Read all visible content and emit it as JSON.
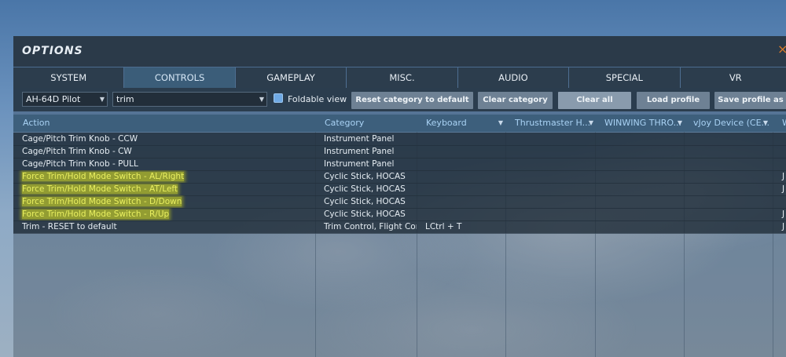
{
  "window": {
    "title": "OPTIONS",
    "close_glyph": "×"
  },
  "tabs": [
    {
      "label": "SYSTEM",
      "active": false
    },
    {
      "label": "CONTROLS",
      "active": true
    },
    {
      "label": "GAMEPLAY",
      "active": false
    },
    {
      "label": "MISC.",
      "active": false
    },
    {
      "label": "AUDIO",
      "active": false
    },
    {
      "label": "SPECIAL",
      "active": false
    },
    {
      "label": "VR",
      "active": false
    }
  ],
  "toolbar": {
    "aircraft_select": "AH-64D Pilot",
    "category_filter": "trim",
    "foldable_view_label": "Foldable view",
    "foldable_view_checked": true,
    "buttons": {
      "reset_category": "Reset category to default",
      "clear_category": "Clear category",
      "clear_all": "Clear all",
      "load_profile": "Load profile",
      "save_profile_as": "Save profile as"
    }
  },
  "table": {
    "columns": [
      "Action",
      "Category",
      "Keyboard",
      "Thrustmaster H...",
      "WINWING THRO...",
      "vJoy Device (CE...",
      "W"
    ],
    "rows": [
      {
        "action": "Cage/Pitch Trim Knob - CCW",
        "category": "Instrument Panel",
        "keyboard": "",
        "last": "",
        "highlighted": false
      },
      {
        "action": "Cage/Pitch Trim Knob - CW",
        "category": "Instrument Panel",
        "keyboard": "",
        "last": "",
        "highlighted": false
      },
      {
        "action": "Cage/Pitch Trim Knob - PULL",
        "category": "Instrument Panel",
        "keyboard": "",
        "last": "",
        "highlighted": false
      },
      {
        "action": "Force Trim/Hold Mode Switch - AL/Right",
        "category": "Cyclic Stick, HOCAS",
        "keyboard": "",
        "last": "J",
        "highlighted": true
      },
      {
        "action": "Force Trim/Hold Mode Switch - AT/Left",
        "category": "Cyclic Stick, HOCAS",
        "keyboard": "",
        "last": "J",
        "highlighted": true
      },
      {
        "action": "Force Trim/Hold Mode Switch - D/Down",
        "category": "Cyclic Stick, HOCAS",
        "keyboard": "",
        "last": "",
        "highlighted": true
      },
      {
        "action": "Force Trim/Hold Mode Switch - R/Up",
        "category": "Cyclic Stick, HOCAS",
        "keyboard": "",
        "last": "J",
        "highlighted": true
      },
      {
        "action": "Trim - RESET to default",
        "category": "Trim Control, Flight Control",
        "keyboard": "LCtrl + T",
        "last": "J",
        "highlighted": false
      }
    ]
  },
  "colors": {
    "header_text": "#a9d2f4",
    "highlight": "#e6eb1e",
    "active_tab": "#3b5d79",
    "checkbox": "#6fa9e4",
    "close": "#d87a2a"
  },
  "icons": [
    "close-icon",
    "dropdown-arrow-icon",
    "sort-arrow-icon",
    "checkbox-icon"
  ]
}
